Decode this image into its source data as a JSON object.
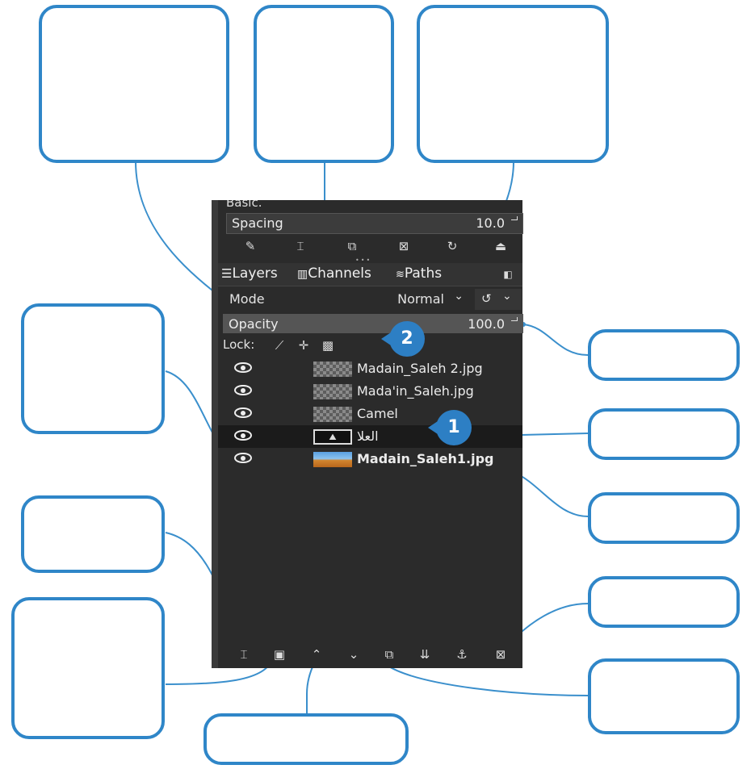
{
  "brush_panel": {
    "preset_label": "Basic.",
    "spacing_label": "Spacing",
    "spacing_value": "10.0",
    "toolbar_icons": [
      "edit-brush-icon",
      "new-brush-icon",
      "duplicate-brush-icon",
      "delete-brush-icon",
      "refresh-brush-icon",
      "open-brush-folder-icon"
    ]
  },
  "tabs": [
    {
      "label": "Layers",
      "icon": "layers-icon"
    },
    {
      "label": "Channels",
      "icon": "channels-icon"
    },
    {
      "label": "Paths",
      "icon": "paths-icon"
    }
  ],
  "mode": {
    "label": "Mode",
    "value": "Normal"
  },
  "opacity": {
    "label": "Opacity",
    "value": "100.0"
  },
  "lock": {
    "label": "Lock:",
    "icons": [
      "lock-pixels-icon",
      "lock-position-icon",
      "lock-alpha-icon"
    ]
  },
  "layers": [
    {
      "name": "Madain_Saleh 2.jpg",
      "thumb": "checker",
      "selected": false,
      "bold": false
    },
    {
      "name": "Mada'in_Saleh.jpg",
      "thumb": "checker",
      "selected": false,
      "bold": false
    },
    {
      "name": "Camel",
      "thumb": "checker",
      "selected": false,
      "bold": false
    },
    {
      "name": "العلا",
      "thumb": "text",
      "selected": true,
      "bold": false
    },
    {
      "name": "Madain_Saleh1.jpg",
      "thumb": "desert",
      "selected": false,
      "bold": true
    }
  ],
  "markers": [
    "1",
    "2"
  ],
  "bottom_toolbar": [
    "new-layer-icon",
    "new-layer-group-icon",
    "raise-layer-icon",
    "lower-layer-icon",
    "duplicate-layer-icon",
    "merge-layer-icon",
    "anchor-layer-icon",
    "delete-layer-icon"
  ],
  "colors": {
    "accent": "#2f86c8",
    "panel_bg": "#2b2b2b"
  }
}
